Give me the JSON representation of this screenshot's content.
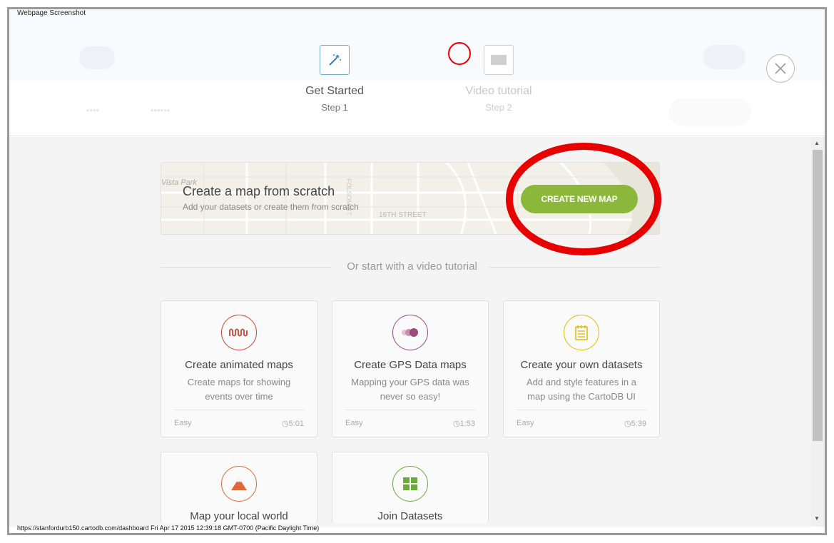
{
  "caption": "Webpage Screenshot",
  "status_bar": "https://stanfordurb150.cartodb.com/dashboard Fri Apr 17 2015 12:39:18 GMT-0700 (Pacific Daylight Time)",
  "steps": [
    {
      "title": "Get Started",
      "sub": "Step 1",
      "icon": "magic-wand-icon"
    },
    {
      "title": "Video tutorial",
      "sub": "Step 2",
      "icon": "video-icon"
    }
  ],
  "create_card": {
    "title": "Create a map from scratch",
    "subtitle": "Add your datasets or create them from scratch",
    "button": "CREATE NEW MAP",
    "map_labels": [
      "Vista Park",
      "16TH STREET",
      "FOLSOM ST"
    ]
  },
  "divider_text": "Or start with a video tutorial",
  "tutorials": [
    {
      "title": "Create animated maps",
      "desc": "Create maps for showing events over time",
      "level": "Easy",
      "duration": "5:01",
      "icon": "animation-wave-icon",
      "color": "#c9452f"
    },
    {
      "title": "Create GPS Data maps",
      "desc": "Mapping your GPS data was never so easy!",
      "level": "Easy",
      "duration": "1:53",
      "icon": "gps-dots-icon",
      "color": "#9b4a7a"
    },
    {
      "title": "Create your own datasets",
      "desc": "Add and style features in a map using the CartoDB UI",
      "level": "Easy",
      "duration": "5:39",
      "icon": "notepad-icon",
      "color": "#e8b800"
    },
    {
      "title": "Map your local world",
      "icon": "mountain-icon",
      "color": "#e0683a"
    },
    {
      "title": "Join Datasets",
      "icon": "table-grid-icon",
      "color": "#6aab3a"
    }
  ]
}
